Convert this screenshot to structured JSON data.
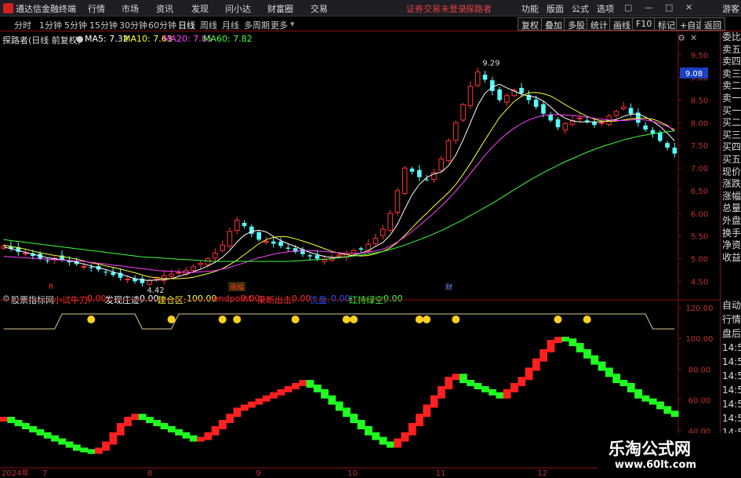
{
  "titlebar": {
    "app_name": "通达信金融终端",
    "menu": [
      "行情",
      "市场",
      "资讯",
      "发现",
      "问小达",
      "财富圈",
      "交易"
    ],
    "notice": "证券交易未登录",
    "stock_link": "探路者",
    "right_menu": [
      "功能",
      "版面",
      "公式",
      "选项"
    ],
    "guest": "游客"
  },
  "periodbar": {
    "periods": [
      "分时",
      "1分钟",
      "5分钟",
      "15分钟",
      "30分钟",
      "60分钟",
      "日线",
      "周线",
      "月线",
      "多周期",
      "更多"
    ],
    "active": "日线",
    "tools": [
      "复权",
      "叠加",
      "多股",
      "统计",
      "画线",
      "F10",
      "标记",
      "+自选",
      "返回"
    ]
  },
  "legend": {
    "stock": "探路者(日线 前复权)",
    "ma5_label": "MA5: 7.32",
    "ma10_label": "MA10: 7.63",
    "ma20_label": "MA20: 7.85",
    "ma60_label": "MA60: 7.82"
  },
  "sidepanel_top": [
    "委比",
    "卖五",
    "卖四",
    "卖三",
    "卖二",
    "卖一",
    "买一",
    "买二",
    "买三",
    "买四",
    "买五",
    "现价",
    "涨跌",
    "涨幅",
    "总量",
    "外盘",
    "换手",
    "净资",
    "收益"
  ],
  "sidepanel_bottom": [
    "自动",
    "行情",
    "盘后",
    "14:5",
    "14:5",
    "14:5",
    "14:5",
    "14:5",
    "14:5",
    "14:5"
  ],
  "indicator": {
    "name": "股票指标网",
    "items": [
      {
        "label": "小试牛刀:",
        "value": "0.00",
        "color": "#ff3030"
      },
      {
        "label": "发现庄迹:",
        "value": "0.00",
        "color": "#ffffff"
      },
      {
        "label": "建仓区:",
        "value": "100.00",
        "color": "#ffff40"
      },
      {
        "label": "endpoint:",
        "value": "0.00",
        "color": "#ff3030"
      },
      {
        "label": "果断出击:",
        "value": "0.00",
        "color": "#ff3030"
      },
      {
        "label": "洗盘:",
        "value": "0.00",
        "color": "#3050ff"
      },
      {
        "label": "红持绿空:",
        "value": "0.00",
        "color": "#40ff40"
      }
    ]
  },
  "watermark": {
    "title": "乐淘公式网",
    "url": "www.60lt.com"
  },
  "markers": {
    "low_label": "4.42",
    "high_label": "9.29",
    "current_price": "9.08",
    "event1": "R",
    "event2": "涨幅",
    "event3": "财"
  },
  "x_axis_labels": [
    {
      "label": "2024年",
      "at": 0.0
    },
    {
      "label": "7",
      "at": 0.06
    },
    {
      "label": "8",
      "at": 0.215
    },
    {
      "label": "9",
      "at": 0.375
    },
    {
      "label": "10",
      "at": 0.51
    },
    {
      "label": "11",
      "at": 0.64
    },
    {
      "label": "12",
      "at": 0.79
    }
  ],
  "chart_data": {
    "type": "candlestick",
    "price_axis": {
      "ticks": [
        "9.50",
        "9.00",
        "8.50",
        "8.00",
        "7.50",
        "7.00",
        "6.50",
        "6.00",
        "5.50",
        "5.00",
        "4.50"
      ],
      "range": [
        4.3,
        9.6
      ]
    },
    "indicator_axis": {
      "ticks": [
        "120.00",
        "100.00",
        "80.00",
        "60.00",
        "40.00"
      ],
      "range": [
        20,
        120
      ]
    },
    "closes": [
      5.28,
      5.22,
      5.15,
      5.12,
      5.06,
      5.0,
      4.96,
      5.01,
      4.98,
      4.92,
      4.88,
      4.83,
      4.8,
      4.76,
      4.7,
      4.64,
      4.58,
      4.55,
      4.5,
      4.46,
      4.52,
      4.58,
      4.62,
      4.66,
      4.7,
      4.74,
      4.82,
      4.9,
      5.0,
      5.12,
      5.3,
      5.6,
      5.85,
      5.72,
      5.55,
      5.42,
      5.38,
      5.33,
      5.28,
      5.22,
      5.15,
      5.1,
      5.05,
      5.0,
      4.98,
      5.02,
      5.08,
      5.12,
      5.18,
      5.2,
      5.32,
      5.45,
      5.65,
      6.0,
      6.5,
      7.0,
      6.92,
      6.8,
      6.75,
      6.9,
      7.2,
      7.6,
      8.0,
      8.4,
      8.8,
      9.12,
      8.95,
      8.7,
      8.5,
      8.6,
      8.72,
      8.65,
      8.5,
      8.35,
      8.2,
      8.05,
      7.9,
      7.98,
      8.05,
      8.1,
      8.02,
      7.95,
      8.0,
      8.15,
      8.25,
      8.35,
      8.2,
      8.0,
      7.85,
      7.75,
      7.6,
      7.45,
      7.32
    ],
    "ma5": [
      5.26,
      5.22,
      5.18,
      5.14,
      5.1,
      5.06,
      5.02,
      5.0,
      4.98,
      4.96,
      4.92,
      4.88,
      4.84,
      4.8,
      4.76,
      4.71,
      4.66,
      4.61,
      4.56,
      4.53,
      4.52,
      4.53,
      4.54,
      4.56,
      4.61,
      4.66,
      4.71,
      4.77,
      4.84,
      4.92,
      5.03,
      5.18,
      5.37,
      5.52,
      5.6,
      5.63,
      5.59,
      5.49,
      5.4,
      5.33,
      5.27,
      5.2,
      5.14,
      5.09,
      5.05,
      5.03,
      5.03,
      5.04,
      5.08,
      5.12,
      5.18,
      5.27,
      5.36,
      5.52,
      5.76,
      6.1,
      6.41,
      6.64,
      6.79,
      6.87,
      6.91,
      7.05,
      7.29,
      7.62,
      8.0,
      8.38,
      8.65,
      8.79,
      8.85,
      8.77,
      8.7,
      8.63,
      8.59,
      8.56,
      8.48,
      8.35,
      8.2,
      8.1,
      8.04,
      8.02,
      8.02,
      8.02,
      8.02,
      8.05,
      8.07,
      8.14,
      8.19,
      8.19,
      8.13,
      8.03,
      7.92,
      7.77,
      7.6
    ],
    "ma10": [
      5.3,
      5.27,
      5.24,
      5.21,
      5.17,
      5.13,
      5.1,
      5.07,
      5.05,
      5.02,
      4.99,
      4.95,
      4.91,
      4.88,
      4.84,
      4.81,
      4.77,
      4.73,
      4.69,
      4.64,
      4.6,
      4.58,
      4.56,
      4.56,
      4.56,
      4.57,
      4.59,
      4.63,
      4.67,
      4.72,
      4.78,
      4.87,
      4.97,
      5.09,
      5.21,
      5.33,
      5.42,
      5.47,
      5.49,
      5.48,
      5.44,
      5.39,
      5.34,
      5.28,
      5.22,
      5.16,
      5.12,
      5.09,
      5.07,
      5.06,
      5.07,
      5.11,
      5.16,
      5.24,
      5.36,
      5.51,
      5.68,
      5.85,
      6.0,
      6.16,
      6.31,
      6.46,
      6.64,
      6.86,
      7.1,
      7.36,
      7.62,
      7.87,
      8.12,
      8.3,
      8.47,
      8.58,
      8.66,
      8.67,
      8.64,
      8.59,
      8.5,
      8.4,
      8.31,
      8.22,
      8.14,
      8.08,
      8.04,
      8.03,
      8.04,
      8.06,
      8.09,
      8.1,
      8.1,
      8.08,
      8.02,
      7.94,
      7.82
    ],
    "ma20": [
      5.05,
      5.04,
      5.03,
      5.02,
      5.01,
      5.0,
      4.99,
      4.98,
      4.97,
      4.96,
      4.95,
      4.94,
      4.92,
      4.9,
      4.88,
      4.86,
      4.84,
      4.82,
      4.8,
      4.78,
      4.76,
      4.74,
      4.73,
      4.72,
      4.71,
      4.7,
      4.7,
      4.71,
      4.72,
      4.74,
      4.77,
      4.81,
      4.86,
      4.91,
      4.97,
      5.02,
      5.06,
      5.1,
      5.13,
      5.15,
      5.17,
      5.18,
      5.18,
      5.17,
      5.16,
      5.14,
      5.13,
      5.12,
      5.12,
      5.12,
      5.14,
      5.17,
      5.21,
      5.28,
      5.37,
      5.48,
      5.6,
      5.73,
      5.87,
      6.01,
      6.16,
      6.32,
      6.49,
      6.68,
      6.88,
      7.08,
      7.28,
      7.46,
      7.62,
      7.76,
      7.88,
      7.98,
      8.06,
      8.12,
      8.16,
      8.18,
      8.18,
      8.17,
      8.16,
      8.14,
      8.12,
      8.1,
      8.08,
      8.06,
      8.05,
      8.05,
      8.06,
      8.07,
      8.06,
      8.03,
      7.98,
      7.92,
      7.85
    ],
    "ma60": [
      5.42,
      5.4,
      5.38,
      5.36,
      5.34,
      5.32,
      5.3,
      5.28,
      5.26,
      5.24,
      5.22,
      5.2,
      5.18,
      5.16,
      5.14,
      5.12,
      5.1,
      5.08,
      5.06,
      5.04,
      5.03,
      5.02,
      5.01,
      5.0,
      4.99,
      4.98,
      4.97,
      4.96,
      4.95,
      4.94,
      4.94,
      4.94,
      4.94,
      4.94,
      4.94,
      4.94,
      4.94,
      4.94,
      4.94,
      4.94,
      4.95,
      4.96,
      4.97,
      4.98,
      4.99,
      5.0,
      5.02,
      5.04,
      5.06,
      5.08,
      5.1,
      5.13,
      5.16,
      5.2,
      5.25,
      5.3,
      5.36,
      5.42,
      5.48,
      5.55,
      5.62,
      5.7,
      5.78,
      5.86,
      5.95,
      6.04,
      6.13,
      6.22,
      6.32,
      6.42,
      6.52,
      6.62,
      6.72,
      6.81,
      6.9,
      6.98,
      7.06,
      7.14,
      7.21,
      7.28,
      7.35,
      7.41,
      7.47,
      7.52,
      7.57,
      7.62,
      7.66,
      7.7,
      7.73,
      7.76,
      7.78,
      7.8,
      7.82
    ],
    "indicator_values": [
      48,
      46,
      44,
      42,
      40,
      38,
      36,
      34,
      32,
      30,
      28,
      27,
      26,
      28,
      32,
      38,
      44,
      48,
      50,
      48,
      46,
      44,
      42,
      40,
      38,
      36,
      34,
      35,
      38,
      42,
      46,
      50,
      54,
      56,
      58,
      60,
      62,
      64,
      66,
      68,
      70,
      72,
      69,
      66,
      62,
      58,
      54,
      50,
      46,
      42,
      38,
      35,
      32,
      30,
      34,
      38,
      44,
      50,
      56,
      62,
      68,
      74,
      76,
      72,
      70,
      68,
      66,
      64,
      62,
      66,
      70,
      74,
      80,
      86,
      92,
      98,
      100,
      99,
      96,
      92,
      88,
      84,
      80,
      76,
      72,
      70,
      66,
      62,
      60,
      58,
      55,
      52,
      50
    ]
  }
}
